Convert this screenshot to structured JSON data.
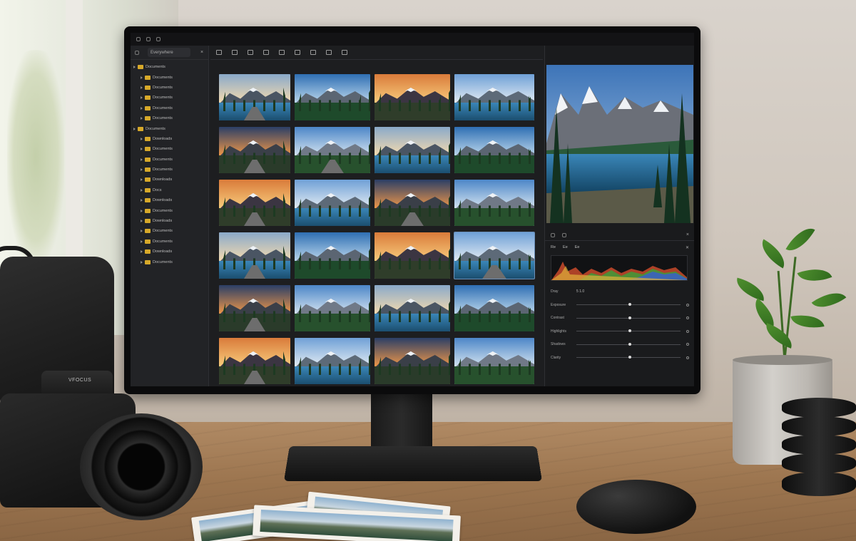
{
  "app": {
    "search_placeholder": "Everywhere"
  },
  "sidebar": {
    "items": [
      {
        "label": "Documents",
        "level": 0
      },
      {
        "label": "Documents",
        "level": 1
      },
      {
        "label": "Documents",
        "level": 1
      },
      {
        "label": "Documents",
        "level": 1
      },
      {
        "label": "Documents",
        "level": 1
      },
      {
        "label": "Documents",
        "level": 1
      },
      {
        "label": "Documents",
        "level": 0
      },
      {
        "label": "Downloads",
        "level": 1
      },
      {
        "label": "Documents",
        "level": 1
      },
      {
        "label": "Documents",
        "level": 1
      },
      {
        "label": "Documents",
        "level": 1
      },
      {
        "label": "Downloads",
        "level": 1
      },
      {
        "label": "Docs",
        "level": 1
      },
      {
        "label": "Downloads",
        "level": 1
      },
      {
        "label": "Documents",
        "level": 1
      },
      {
        "label": "Downloads",
        "level": 1
      },
      {
        "label": "Documents",
        "level": 1
      },
      {
        "label": "Documents",
        "level": 1
      },
      {
        "label": "Downloads",
        "level": 1
      },
      {
        "label": "Documents",
        "level": 1
      }
    ]
  },
  "develop": {
    "tabs": [
      "Re",
      "Ee",
      "Ee"
    ],
    "mode_label": "Dray",
    "readout": "5  1.0",
    "sliders": [
      {
        "label": "Exposure",
        "value": 0.5
      },
      {
        "label": "Contrast",
        "value": 0.5
      },
      {
        "label": "Highlights",
        "value": 0.5
      },
      {
        "label": "Shadows",
        "value": 0.5
      },
      {
        "label": "Clarity",
        "value": 0.5
      }
    ]
  },
  "camera": {
    "brand": "VFOCUS"
  },
  "thumbnails": {
    "count": 24,
    "selected_index": 15
  }
}
